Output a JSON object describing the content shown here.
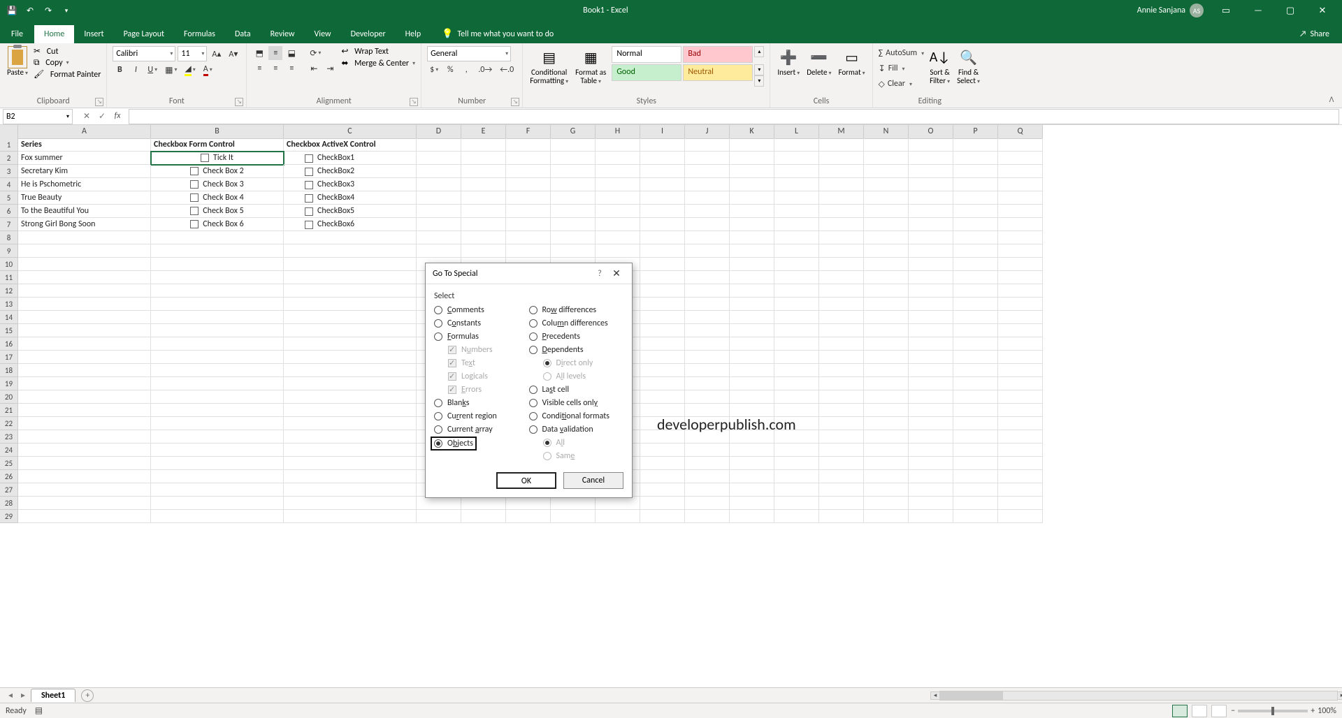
{
  "titlebar": {
    "title": "Book1 - Excel",
    "user_name": "Annie Sanjana",
    "user_initials": "AS"
  },
  "tabs": {
    "file": "File",
    "home": "Home",
    "insert": "Insert",
    "pagelayout": "Page Layout",
    "formulas": "Formulas",
    "data": "Data",
    "review": "Review",
    "view": "View",
    "developer": "Developer",
    "help": "Help",
    "tellme": "Tell me what you want to do",
    "share": "Share"
  },
  "ribbon": {
    "clipboard": {
      "label": "Clipboard",
      "paste": "Paste",
      "cut": "Cut",
      "copy": "Copy",
      "format_painter": "Format Painter"
    },
    "font": {
      "label": "Font",
      "name": "Calibri",
      "size": "11"
    },
    "alignment": {
      "label": "Alignment",
      "wrap": "Wrap Text",
      "merge": "Merge & Center"
    },
    "number": {
      "label": "Number",
      "format": "General"
    },
    "styles": {
      "label": "Styles",
      "cond": "Conditional\nFormatting",
      "table": "Format as\nTable",
      "normal": "Normal",
      "bad": "Bad",
      "good": "Good",
      "neutral": "Neutral"
    },
    "cells": {
      "label": "Cells",
      "insert": "Insert",
      "delete": "Delete",
      "format": "Format"
    },
    "editing": {
      "label": "Editing",
      "autosum": "AutoSum",
      "fill": "Fill",
      "clear": "Clear",
      "sort": "Sort &\nFilter",
      "find": "Find &\nSelect"
    }
  },
  "namebox": "B2",
  "columns": [
    "A",
    "B",
    "C",
    "D",
    "E",
    "F",
    "G",
    "H",
    "I",
    "J",
    "K",
    "L",
    "M",
    "N",
    "O",
    "P",
    "Q"
  ],
  "rows": 29,
  "cells": {
    "A1": "Series",
    "B1": "Checkbox Form Control",
    "C1": "Checkbox ActiveX Control",
    "A2": "Fox summer",
    "A3": "Secretary Kim",
    "A4": "He is Pschometric",
    "A5": "True Beauty",
    "A6": "To the Beautiful You",
    "A7": "Strong Girl Bong Soon"
  },
  "formcontrols": [
    "Tick It",
    "Check Box 2",
    "Check Box 3",
    "Check Box 4",
    "Check Box 5",
    "Check Box 6"
  ],
  "activexcontrols": [
    "CheckBox1",
    "CheckBox2",
    "CheckBox3",
    "CheckBox4",
    "CheckBox5",
    "CheckBox6"
  ],
  "watermark": "developerpublish.com",
  "sheettab": "Sheet1",
  "status": {
    "ready": "Ready",
    "zoom": "100%"
  },
  "dialog": {
    "title": "Go To Special",
    "select": "Select",
    "left": [
      {
        "key": "comments",
        "label": "Comments",
        "u": "C"
      },
      {
        "key": "constants",
        "label": "Constants",
        "u": "o"
      },
      {
        "key": "formulas",
        "label": "Formulas",
        "u": "F"
      },
      {
        "key": "numbers",
        "label": "Numbers",
        "u": "u",
        "check": true
      },
      {
        "key": "text",
        "label": "Text",
        "u": "x",
        "check": true
      },
      {
        "key": "logicals",
        "label": "Logicals",
        "u": "g",
        "check": true
      },
      {
        "key": "errors",
        "label": "Errors",
        "u": "E",
        "check": true
      },
      {
        "key": "blanks",
        "label": "Blanks",
        "u": "k"
      },
      {
        "key": "region",
        "label": "Current region",
        "u": "r"
      },
      {
        "key": "array",
        "label": "Current array",
        "u": "a"
      },
      {
        "key": "objects",
        "label": "Objects",
        "u": "b",
        "selected": true,
        "highlight": true
      }
    ],
    "right": [
      {
        "key": "rowdiff",
        "label": "Row differences",
        "u": "w"
      },
      {
        "key": "coldiff",
        "label": "Column differences",
        "u": "m"
      },
      {
        "key": "precedents",
        "label": "Precedents",
        "u": "P"
      },
      {
        "key": "dependents",
        "label": "Dependents",
        "u": "D"
      },
      {
        "key": "directonly",
        "label": "Direct only",
        "u": "i",
        "indent": true,
        "disabled": true,
        "selected": true
      },
      {
        "key": "alllevels",
        "label": "All levels",
        "u": "l",
        "indent": true,
        "disabled": true
      },
      {
        "key": "lastcell",
        "label": "Last cell",
        "u": "s"
      },
      {
        "key": "visible",
        "label": "Visible cells only",
        "u": "y"
      },
      {
        "key": "condfmt",
        "label": "Conditional formats",
        "u": "t"
      },
      {
        "key": "datavalid",
        "label": "Data validation",
        "u": "v"
      },
      {
        "key": "all",
        "label": "All",
        "u": "l",
        "indent": true,
        "disabled": true,
        "selected": true
      },
      {
        "key": "same",
        "label": "Same",
        "u": "e",
        "indent": true,
        "disabled": true
      }
    ],
    "ok": "OK",
    "cancel": "Cancel"
  }
}
